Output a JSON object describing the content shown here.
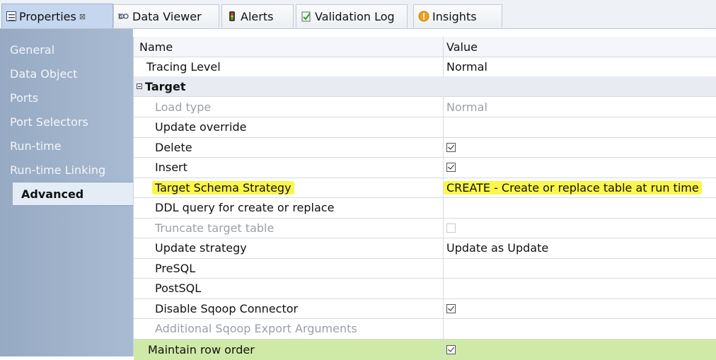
{
  "tabs": [
    {
      "label": "Properties",
      "icon": "properties-icon",
      "active": true,
      "closable": true
    },
    {
      "label": "Data Viewer",
      "icon": "data-viewer-icon"
    },
    {
      "label": "Alerts",
      "icon": "alerts-icon"
    },
    {
      "label": "Validation Log",
      "icon": "validation-log-icon"
    },
    {
      "label": "Insights",
      "icon": "insights-icon"
    }
  ],
  "tab_close_glyph": "⊠",
  "sidebar": {
    "items": [
      {
        "label": "General"
      },
      {
        "label": "Data Object"
      },
      {
        "label": "Ports"
      },
      {
        "label": "Port Selectors"
      },
      {
        "label": "Run-time"
      },
      {
        "label": "Run-time Linking"
      },
      {
        "label": "Advanced",
        "active": true
      }
    ]
  },
  "grid": {
    "headers": {
      "name": "Name",
      "value": "Value"
    },
    "tracing": {
      "name": "Tracing Level",
      "value": "Normal"
    },
    "group": {
      "name": "Target"
    },
    "rows": [
      {
        "name": "Load type",
        "value": "Normal",
        "disabled": true
      },
      {
        "name": "Update override",
        "value": ""
      },
      {
        "name": "Delete",
        "checkbox": true,
        "checked": true
      },
      {
        "name": "Insert",
        "checkbox": true,
        "checked": true
      },
      {
        "name": "Target Schema Strategy",
        "value": "CREATE - Create or replace table at run time",
        "highlighted": true
      },
      {
        "name": "DDL query for create or replace",
        "value": ""
      },
      {
        "name": "Truncate target table",
        "checkbox": true,
        "checked": false,
        "disabled": true
      },
      {
        "name": "Update strategy",
        "value": "Update as Update"
      },
      {
        "name": "PreSQL",
        "value": ""
      },
      {
        "name": "PostSQL",
        "value": ""
      },
      {
        "name": "Disable Sqoop Connector",
        "checkbox": true,
        "checked": true
      },
      {
        "name": "Additional Sqoop Export Arguments",
        "value": "",
        "disabled": true
      }
    ],
    "maintain": {
      "name": "Maintain row order",
      "checkbox": true,
      "checked": true,
      "selected": true
    }
  },
  "colors": {
    "highlight": "#fbf64a",
    "selected_row": "#cfeaa7",
    "sidebar": "#a2b5cd",
    "active_tab": "#c5d6ef"
  }
}
